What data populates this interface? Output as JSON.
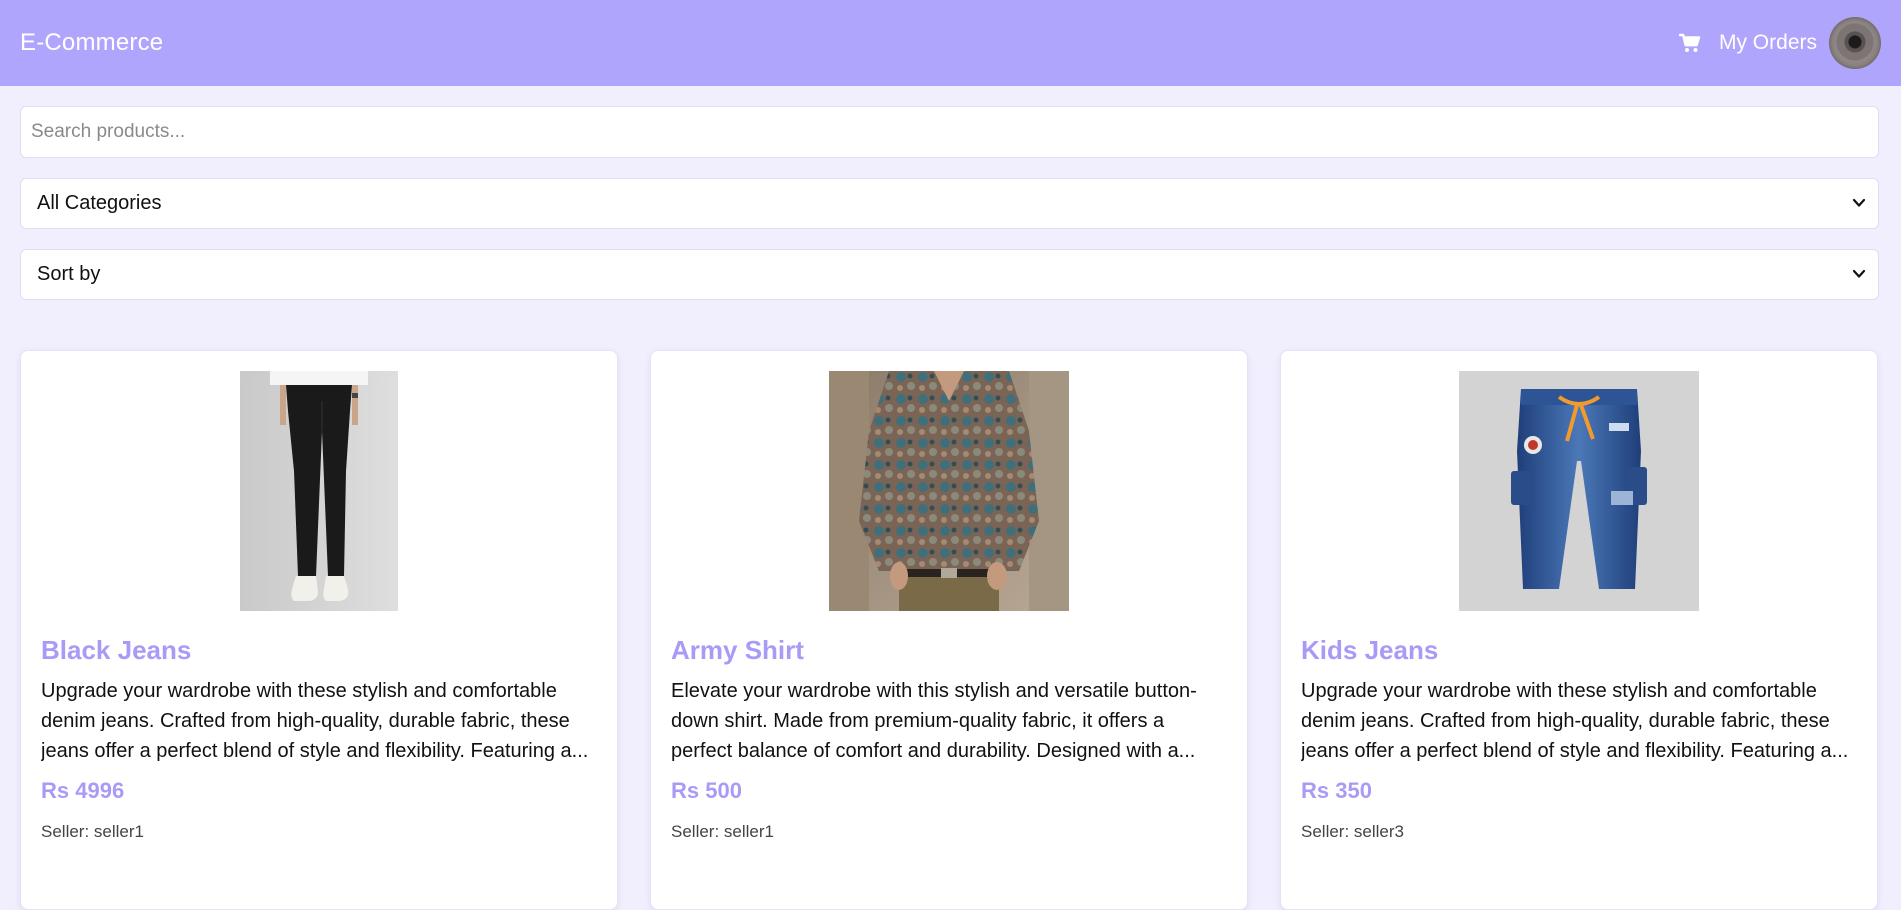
{
  "navbar": {
    "brand": "E-Commerce",
    "cart_icon": "shopping-cart-icon",
    "orders_label": "My Orders",
    "avatar": "user-avatar"
  },
  "filters": {
    "search_placeholder": "Search products...",
    "search_value": "",
    "category_selected": "All Categories",
    "sort_selected": "Sort by"
  },
  "products": [
    {
      "title": "Black Jeans",
      "description": "Upgrade your wardrobe with these stylish and comfortable denim jeans. Crafted from high-quality, durable fabric, these jeans offer a perfect blend of style and flexibility. Featuring a...",
      "price": "Rs 4996",
      "seller": "Seller: seller1",
      "image": "black-trousers-photo"
    },
    {
      "title": "Army Shirt",
      "description": "Elevate your wardrobe with this stylish and versatile button-down shirt. Made from premium-quality fabric, it offers a perfect balance of comfort and durability. Designed with a...",
      "price": "Rs 500",
      "seller": "Seller: seller1",
      "image": "printed-shirt-photo"
    },
    {
      "title": "Kids Jeans",
      "description": "Upgrade your wardrobe with these stylish and comfortable denim jeans. Crafted from high-quality, durable fabric, these jeans offer a perfect blend of style and flexibility. Featuring a...",
      "price": "Rs 350",
      "seller": "Seller: seller3",
      "image": "kids-denim-jeans-photo"
    }
  ],
  "colors": {
    "navbar_bg": "#b0a5fd",
    "page_bg": "#f1effd",
    "accent": "#a89bf7"
  }
}
